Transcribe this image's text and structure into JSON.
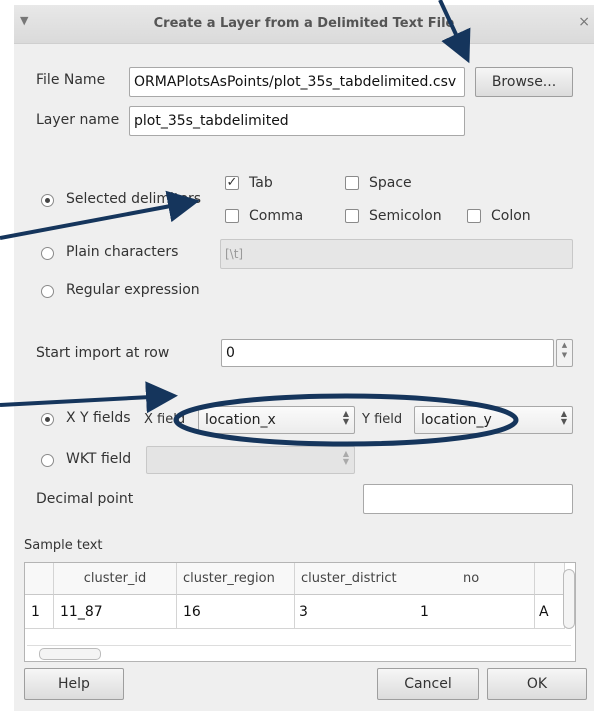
{
  "dialog": {
    "title": "Create a Layer from a Delimited Text File",
    "menu_glyph": "▼",
    "close_glyph": "×"
  },
  "file_name": {
    "label": "File Name",
    "value": "ORMAPlotsAsPoints/plot_35s_tabdelimited.csv",
    "browse": "Browse..."
  },
  "layer_name": {
    "label": "Layer name",
    "value": "plot_35s_tabdelimited"
  },
  "delimiters": {
    "selected_label": "Selected delimiters",
    "plain_label": "Plain characters",
    "plain_value": "[\\t]",
    "regex_label": "Regular expression",
    "checks": [
      {
        "label": "Tab",
        "checked": true
      },
      {
        "label": "Space",
        "checked": false
      },
      {
        "label": "Comma",
        "checked": false
      },
      {
        "label": "Semicolon",
        "checked": false
      },
      {
        "label": "Colon",
        "checked": false
      }
    ]
  },
  "start_row": {
    "label": "Start import at row",
    "value": "0"
  },
  "fields": {
    "xy_label": "X Y fields",
    "x_label": "X field",
    "x_value": "location_x",
    "y_label": "Y field",
    "y_value": "location_y",
    "wkt_label": "WKT field",
    "decimal_label": "Decimal point"
  },
  "sample": {
    "label": "Sample text",
    "headers": [
      "",
      "cluster_id",
      "cluster_region",
      "cluster_district",
      "no",
      ""
    ],
    "rows": [
      [
        "1",
        "11_87",
        "16",
        "3",
        "1",
        "A"
      ]
    ]
  },
  "buttons": {
    "help": "Help",
    "cancel": "Cancel",
    "ok": "OK"
  },
  "colors": {
    "annotation": "#15355c",
    "dialog_bg": "#efefef"
  }
}
